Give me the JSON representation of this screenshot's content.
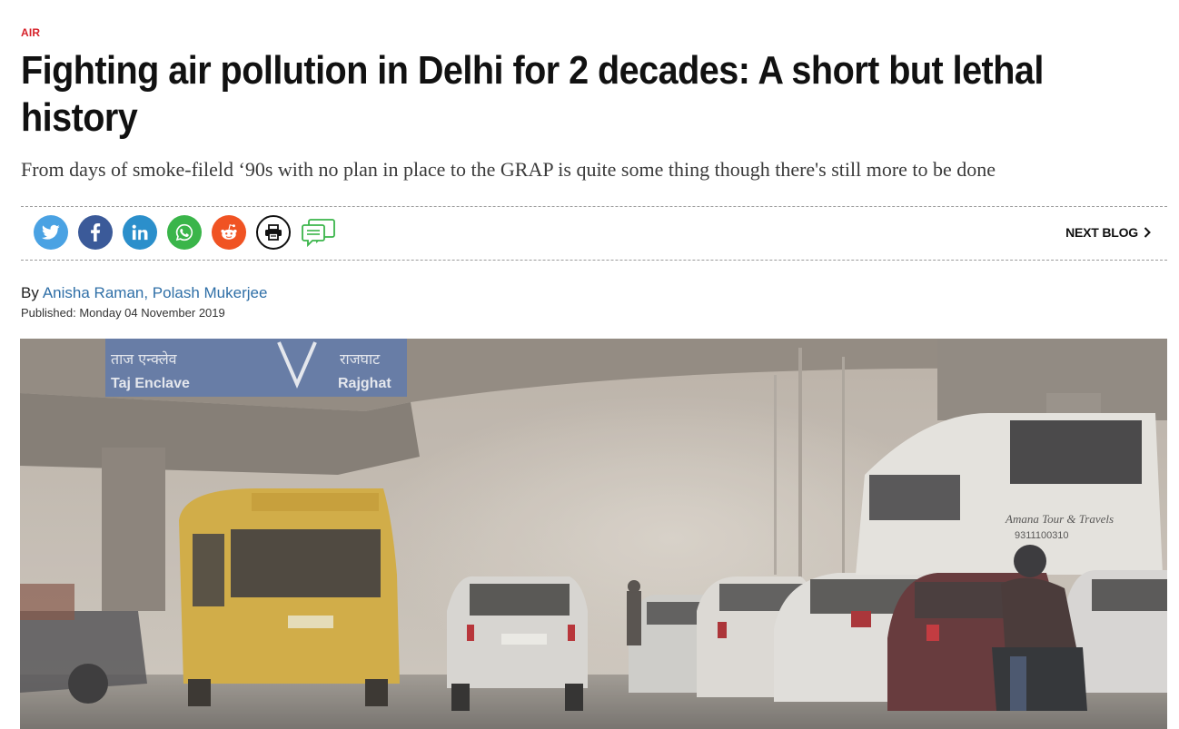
{
  "article": {
    "category": "AIR",
    "title": "Fighting air pollution in Delhi for 2 decades: A short but lethal history",
    "subtitle": "From days of smoke-fileld ‘90s with no plan in place to the GRAP is quite some thing though there's still more to be done",
    "byline_prefix": "By",
    "authors": "Anisha Raman, Polash Mukerjee",
    "published": "Published: Monday 04 November 2019"
  },
  "share": {
    "icons": [
      "twitter-icon",
      "facebook-icon",
      "linkedin-icon",
      "whatsapp-icon",
      "reddit-icon",
      "print-icon",
      "comment-icon"
    ],
    "next_blog_label": "NEXT BLOG"
  },
  "hero_image": {
    "sign_left_hindi": "ताज एन्क्लेव",
    "sign_left_english": "Taj Enclave",
    "sign_right_hindi": "राजघाट",
    "sign_right_english": "Rajghat",
    "bus_label": "Amana Tour & Travels",
    "bus_phone": "9311100310"
  },
  "colors": {
    "accent": "#d6212a",
    "link": "#2f6fa7",
    "twitter": "#4aa2e3",
    "facebook": "#3b5a99",
    "linkedin": "#2b8fcb",
    "whatsapp": "#3ab54a",
    "reddit": "#f05323",
    "comment": "#3ab54a"
  }
}
